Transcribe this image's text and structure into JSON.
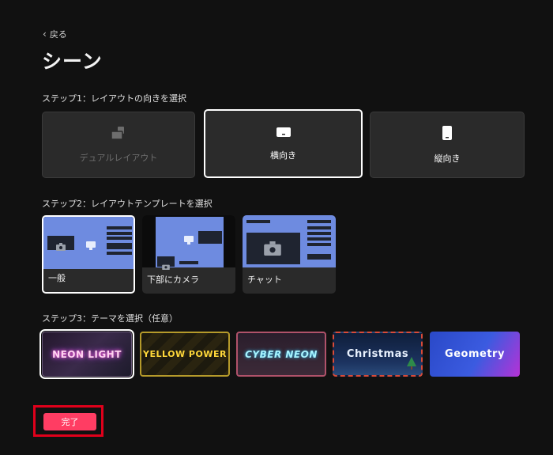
{
  "nav": {
    "back_label": "戻る"
  },
  "page": {
    "title": "シーン"
  },
  "step1": {
    "label": "ステップ1：レイアウトの向きを選択",
    "options": [
      {
        "label": "デュアルレイアウト",
        "icon": "dual-layout-icon",
        "state": "disabled"
      },
      {
        "label": "横向き",
        "icon": "landscape-icon",
        "state": "selected"
      },
      {
        "label": "縦向き",
        "icon": "portrait-icon",
        "state": "normal"
      }
    ]
  },
  "step2": {
    "label": "ステップ2：レイアウトテンプレートを選択",
    "templates": [
      {
        "label": "一般",
        "state": "selected"
      },
      {
        "label": "下部にカメラ",
        "state": "normal"
      },
      {
        "label": "チャット",
        "state": "normal"
      }
    ]
  },
  "step3": {
    "label": "ステップ3：テーマを選択（任意）",
    "themes": [
      {
        "name": "NEON LIGHT",
        "state": "selected"
      },
      {
        "name": "YELLOW POWER",
        "state": "normal"
      },
      {
        "name": "CYBER NEON",
        "state": "normal"
      },
      {
        "name": "Christmas",
        "state": "normal"
      },
      {
        "name": "Geometry",
        "state": "normal"
      }
    ]
  },
  "actions": {
    "done_label": "完了"
  },
  "colors": {
    "accent": "#ff3d63",
    "highlight_box": "#e0001b",
    "template_blue": "#6e8be0"
  }
}
